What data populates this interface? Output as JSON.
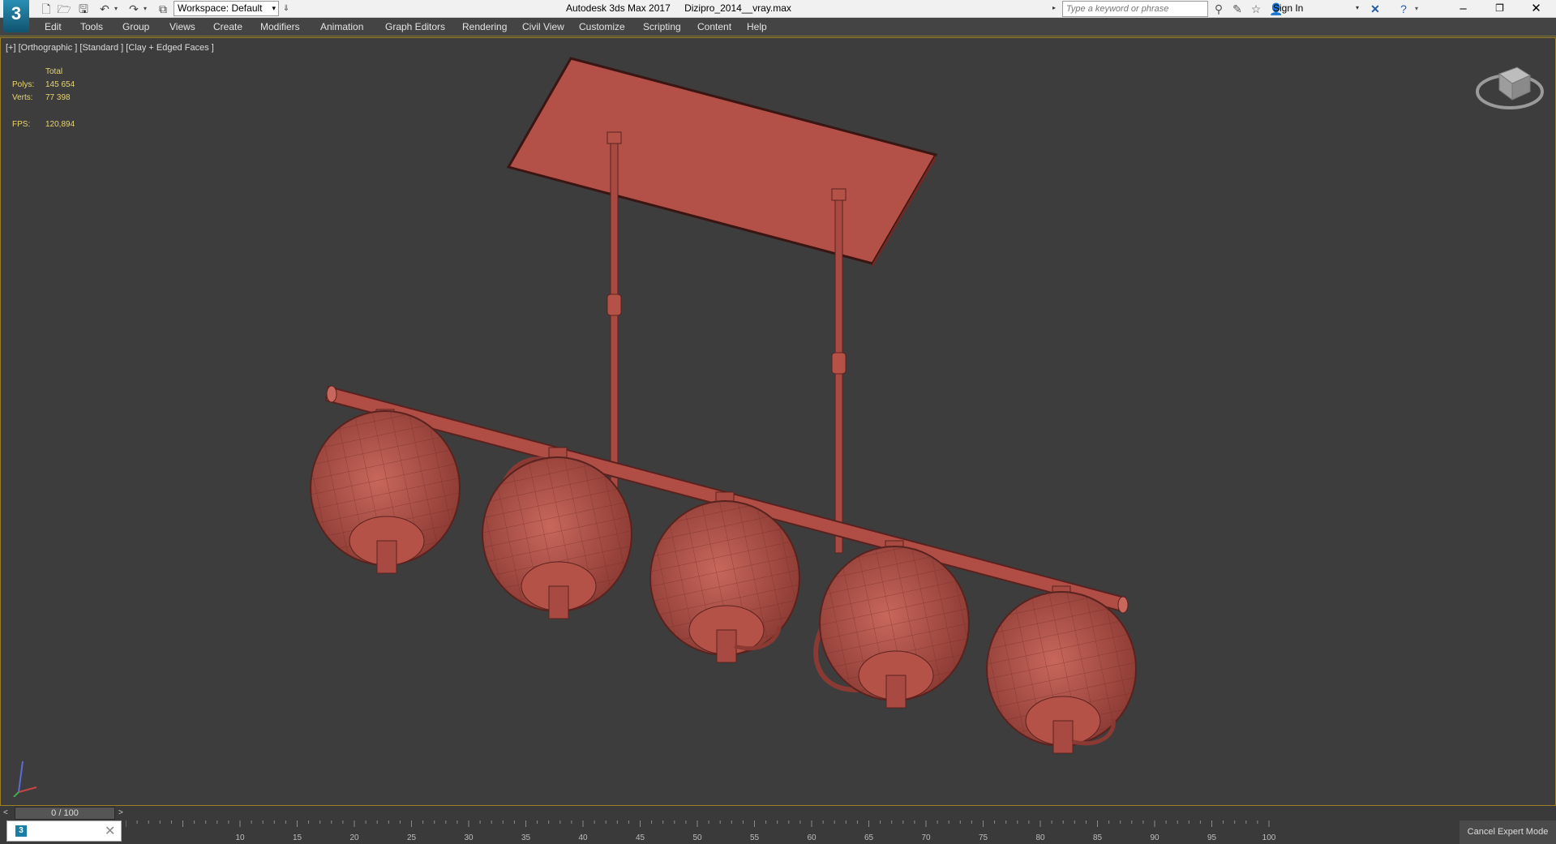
{
  "titlebar": {
    "logo_text": "3",
    "workspace": "Workspace: Default",
    "app_name": "Autodesk 3ds Max 2017",
    "file_name": "Dizipro_2014__vray.max",
    "search_placeholder": "Type a keyword or phrase",
    "sign_in": "Sign In"
  },
  "menu": [
    "Edit",
    "Tools",
    "Group",
    "Views",
    "Create",
    "Modifiers",
    "Animation",
    "Graph Editors",
    "Rendering",
    "Civil View",
    "Customize",
    "Scripting",
    "Content",
    "Help"
  ],
  "viewport": {
    "label": "[+] [Orthographic ] [Standard ] [Clay + Edged Faces ]",
    "stats": {
      "total_label": "Total",
      "polys_label": "Polys:",
      "polys_value": "145 654",
      "verts_label": "Verts:",
      "verts_value": "77 398",
      "fps_label": "FPS:",
      "fps_value": "120,894"
    }
  },
  "timeline": {
    "slider_text": "0 / 100",
    "ticks": [
      "10",
      "15",
      "20",
      "25",
      "30",
      "35",
      "40",
      "45",
      "50",
      "55",
      "60",
      "65",
      "70",
      "75",
      "80",
      "85",
      "90",
      "95",
      "100"
    ]
  },
  "cancel_expert": "Cancel Expert Mode",
  "colors": {
    "model_fill": "#b55248",
    "model_edge": "#6e2a25",
    "viewport_bg": "#3d3d3d",
    "stat_text": "#e8d570"
  }
}
